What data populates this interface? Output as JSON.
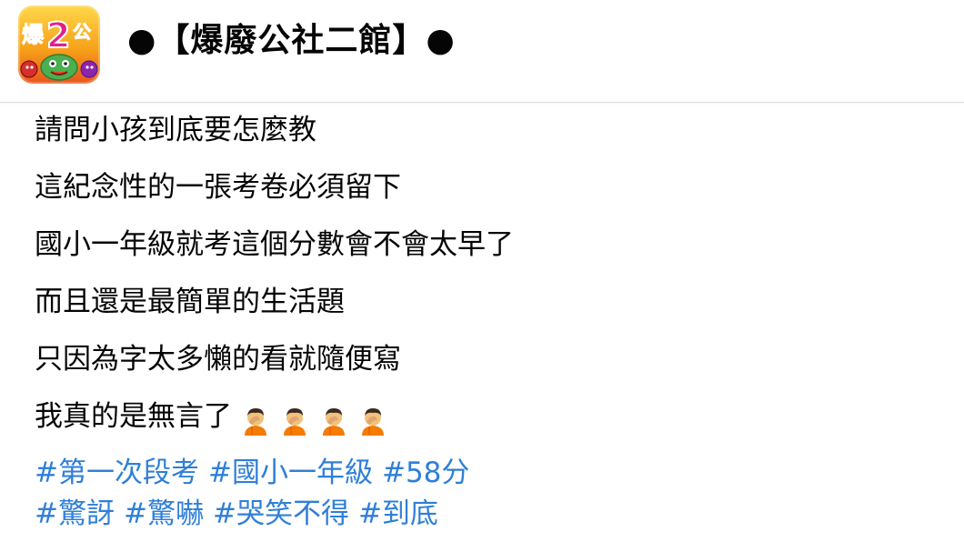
{
  "header": {
    "avatar_text": "爆2公",
    "page_title": "●【爆廢公社二館】●"
  },
  "post": {
    "lines": [
      "請問小孩到底要怎麼教",
      "這紀念性的一張考卷必須留下",
      "國小一年級就考這個分數會不會太早了",
      "而且還是最簡單的生活題",
      "只因為字太多懶的看就隨便寫",
      "我真的是無言了"
    ],
    "emoji": [
      "face-palm-person",
      "face-palm-person",
      "face-palm-person",
      "face-palm-person"
    ],
    "hashtags_row1": [
      "#第一次段考",
      "#國小一年級",
      "#58分"
    ],
    "hashtags_row2": [
      "#驚訝",
      "#驚嚇",
      "#哭笑不得",
      "#到底"
    ]
  },
  "colors": {
    "hashtag": "#2f7fd8",
    "text": "#050505",
    "divider": "#dadde1"
  }
}
